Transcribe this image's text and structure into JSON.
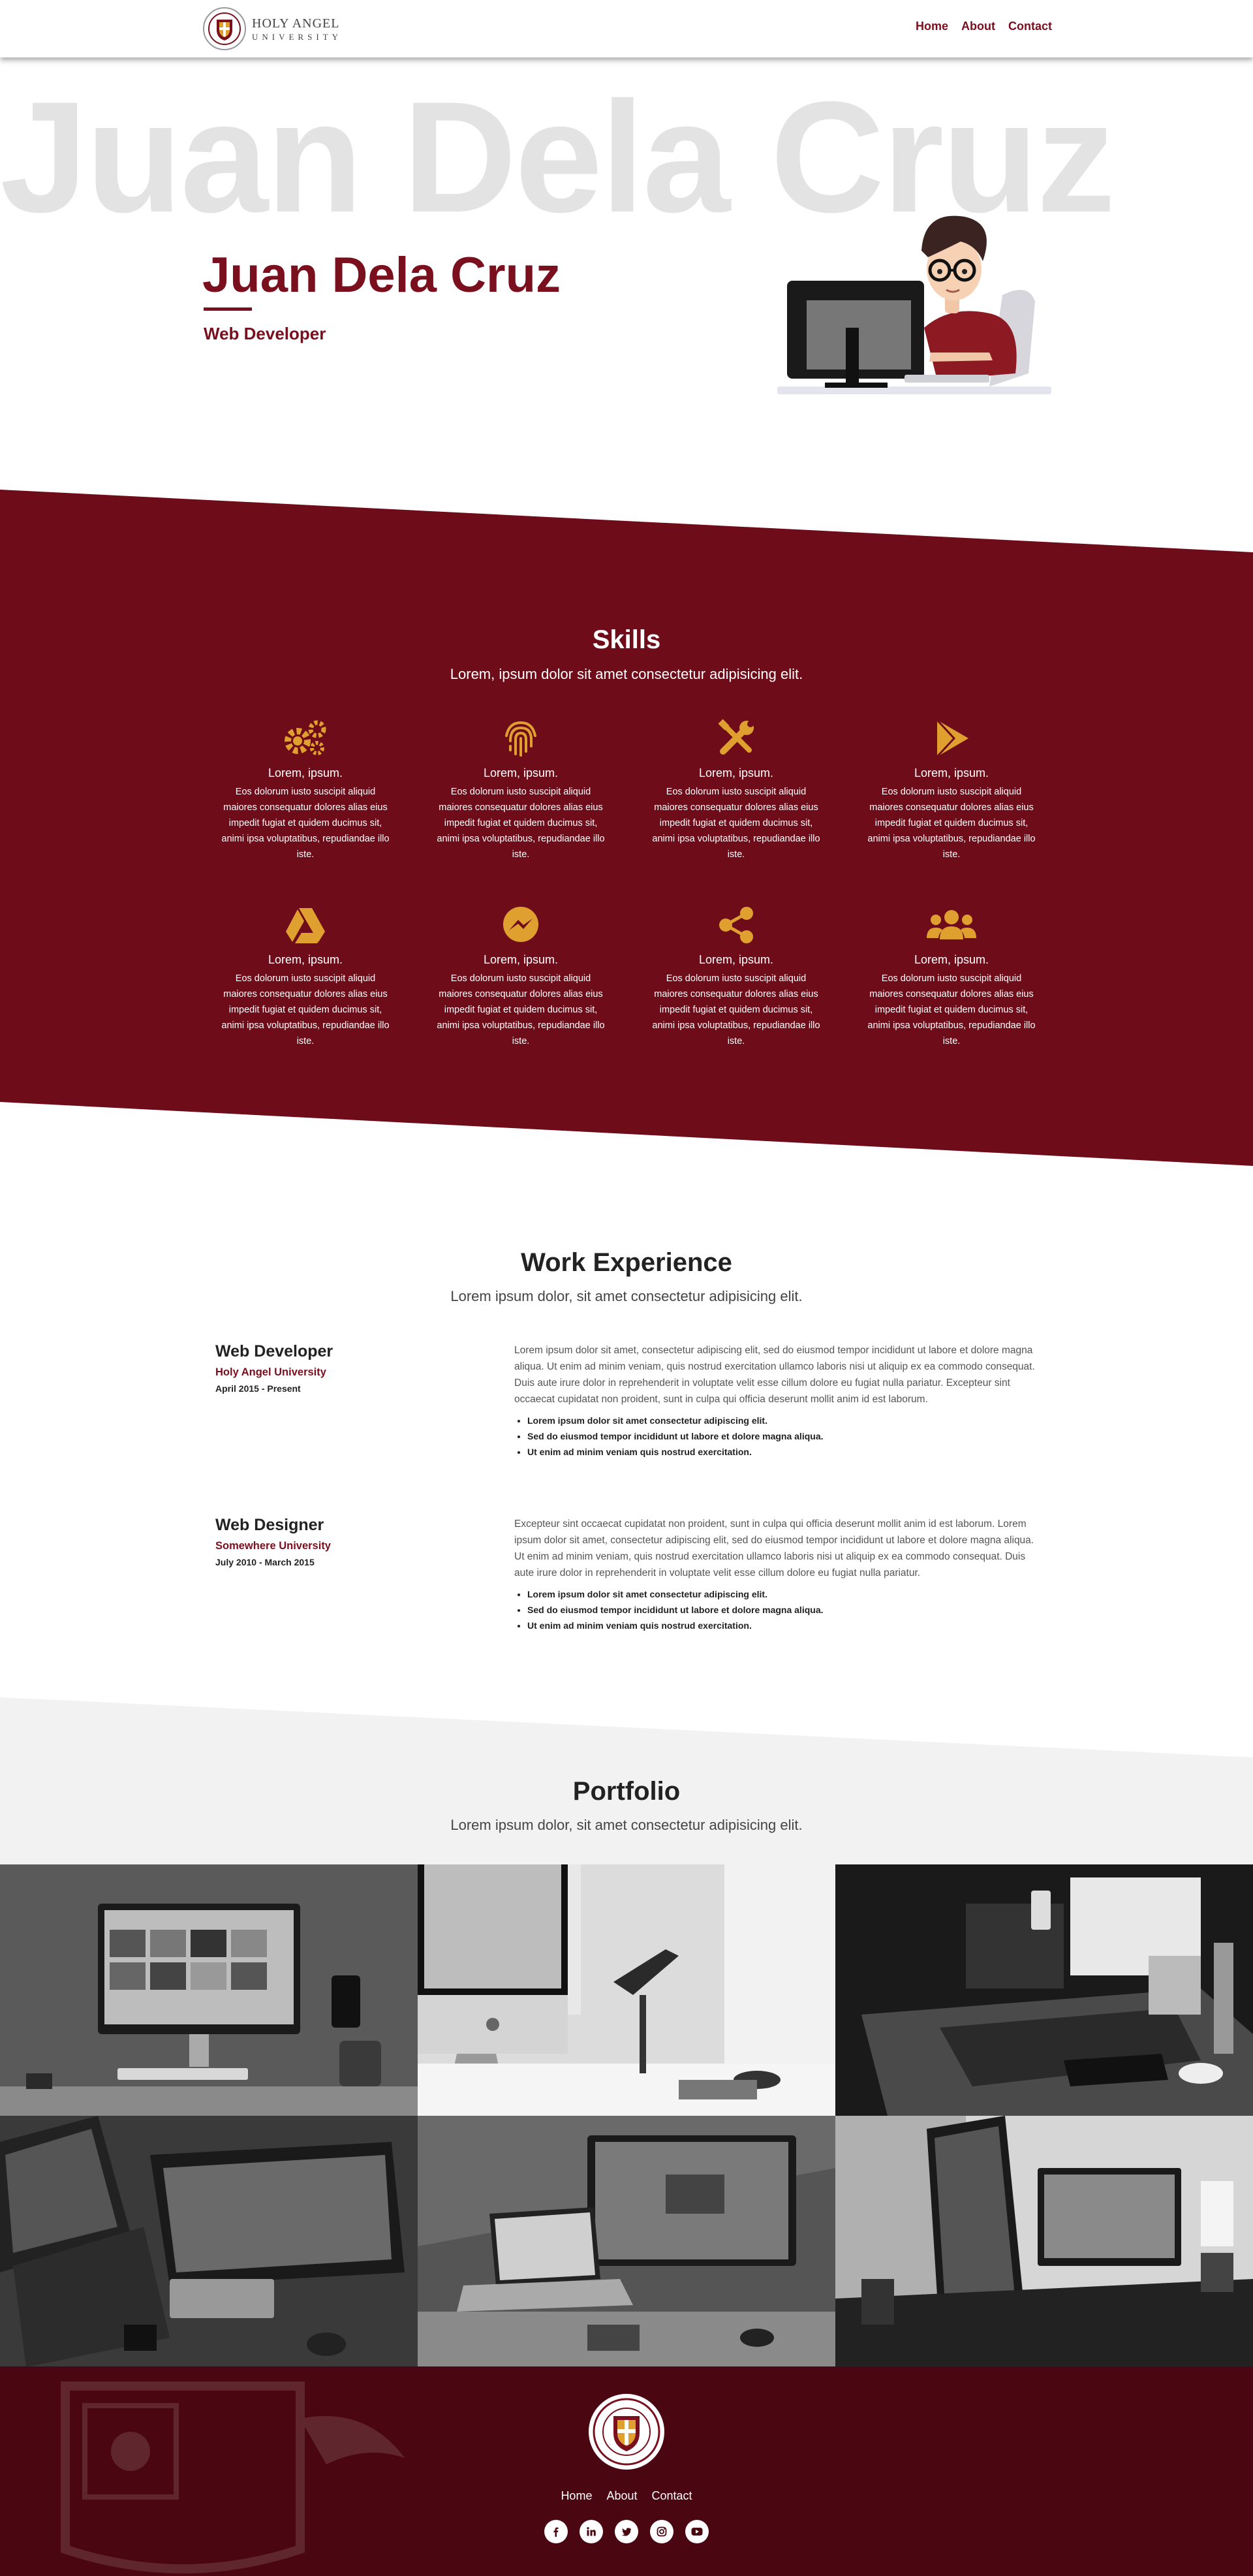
{
  "header": {
    "logo_line1": "HOLY ANGEL",
    "logo_line2": "UNIVERSITY",
    "nav": [
      "Home",
      "About",
      "Contact"
    ]
  },
  "hero": {
    "bg_name": "Juan Dela Cruz",
    "name": "Juan Dela Cruz",
    "role": "Web Developer"
  },
  "skills": {
    "title": "Skills",
    "subtitle": "Lorem, ipsum dolor sit amet consectetur adipisicing elit.",
    "items": [
      {
        "icon": "gears-icon",
        "title": "Lorem, ipsum.",
        "desc": "Eos dolorum iusto suscipit aliquid maiores consequatur dolores alias eius impedit fugiat et quidem ducimus sit, animi ipsa voluptatibus, repudiandae illo iste."
      },
      {
        "icon": "fingerprint-icon",
        "title": "Lorem, ipsum.",
        "desc": "Eos dolorum iusto suscipit aliquid maiores consequatur dolores alias eius impedit fugiat et quidem ducimus sit, animi ipsa voluptatibus, repudiandae illo iste."
      },
      {
        "icon": "tools-icon",
        "title": "Lorem, ipsum.",
        "desc": "Eos dolorum iusto suscipit aliquid maiores consequatur dolores alias eius impedit fugiat et quidem ducimus sit, animi ipsa voluptatibus, repudiandae illo iste."
      },
      {
        "icon": "play-store-icon",
        "title": "Lorem, ipsum.",
        "desc": "Eos dolorum iusto suscipit aliquid maiores consequatur dolores alias eius impedit fugiat et quidem ducimus sit, animi ipsa voluptatibus, repudiandae illo iste."
      },
      {
        "icon": "google-drive-icon",
        "title": "Lorem, ipsum.",
        "desc": "Eos dolorum iusto suscipit aliquid maiores consequatur dolores alias eius impedit fugiat et quidem ducimus sit, animi ipsa voluptatibus, repudiandae illo iste."
      },
      {
        "icon": "messenger-icon",
        "title": "Lorem, ipsum.",
        "desc": "Eos dolorum iusto suscipit aliquid maiores consequatur dolores alias eius impedit fugiat et quidem ducimus sit, animi ipsa voluptatibus, repudiandae illo iste."
      },
      {
        "icon": "share-icon",
        "title": "Lorem, ipsum.",
        "desc": "Eos dolorum iusto suscipit aliquid maiores consequatur dolores alias eius impedit fugiat et quidem ducimus sit, animi ipsa voluptatibus, repudiandae illo iste."
      },
      {
        "icon": "users-icon",
        "title": "Lorem, ipsum.",
        "desc": "Eos dolorum iusto suscipit aliquid maiores consequatur dolores alias eius impedit fugiat et quidem ducimus sit, animi ipsa voluptatibus, repudiandae illo iste."
      }
    ]
  },
  "work": {
    "title": "Work Experience",
    "subtitle": "Lorem ipsum dolor, sit amet consectetur adipisicing elit.",
    "jobs": [
      {
        "title": "Web Developer",
        "company": "Holy Angel University",
        "dates": "April 2015 - Present",
        "description": "Lorem ipsum dolor sit amet, consectetur adipiscing elit, sed do eiusmod tempor incididunt ut labore et dolore magna aliqua. Ut enim ad minim veniam, quis nostrud exercitation ullamco laboris nisi ut aliquip ex ea commodo consequat. Duis aute irure dolor in reprehenderit in voluptate velit esse cillum dolore eu fugiat nulla pariatur. Excepteur sint occaecat cupidatat non proident, sunt in culpa qui officia deserunt mollit anim id est laborum.",
        "bullets": [
          "Lorem ipsum dolor sit amet consectetur adipiscing elit.",
          "Sed do eiusmod tempor incididunt ut labore et dolore magna aliqua.",
          "Ut enim ad minim veniam quis nostrud exercitation."
        ]
      },
      {
        "title": "Web Designer",
        "company": "Somewhere University",
        "dates": "July 2010 - March 2015",
        "description": "Excepteur sint occaecat cupidatat non proident, sunt in culpa qui officia deserunt mollit anim id est laborum. Lorem ipsum dolor sit amet, consectetur adipiscing elit, sed do eiusmod tempor incididunt ut labore et dolore magna aliqua. Ut enim ad minim veniam, quis nostrud exercitation ullamco laboris nisi ut aliquip ex ea commodo consequat. Duis aute irure dolor in reprehenderit in voluptate velit esse cillum dolore eu fugiat nulla pariatur.",
        "bullets": [
          "Lorem ipsum dolor sit amet consectetur adipiscing elit.",
          "Sed do eiusmod tempor incididunt ut labore et dolore magna aliqua.",
          "Ut enim ad minim veniam quis nostrud exercitation."
        ]
      }
    ]
  },
  "portfolio": {
    "title": "Portfolio",
    "subtitle": "Lorem ipsum dolor, sit amet consectetur adipisicing elit."
  },
  "footer": {
    "nav": [
      "Home",
      "About",
      "Contact"
    ],
    "social": [
      "facebook-icon",
      "linkedin-icon",
      "twitter-icon",
      "instagram-icon",
      "youtube-icon"
    ]
  },
  "colors": {
    "brand": "#7a0f1d",
    "footer": "#4a0711",
    "accent_icon": "#e0a030",
    "portfolio_bg": "#f2f2f2"
  }
}
